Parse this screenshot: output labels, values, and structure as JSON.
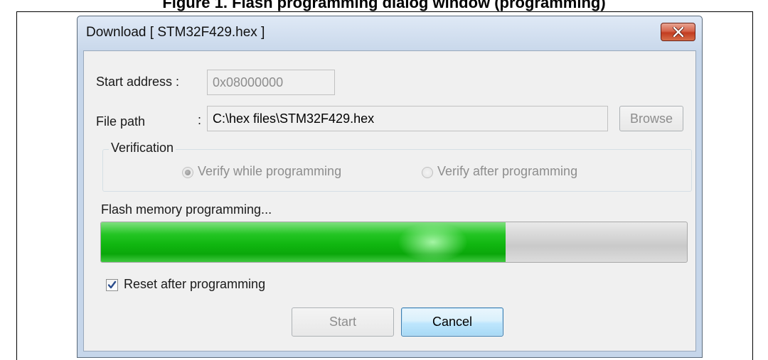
{
  "page": {
    "caption": "Figure 1. Flash programming dialog window (programming)"
  },
  "window": {
    "title": "Download [ STM32F429.hex ]"
  },
  "form": {
    "start_address_label": "Start address :",
    "start_address_value": "0x08000000",
    "file_path_label": "File path",
    "file_path_colon": ":",
    "file_path_value": "C:\\hex files\\STM32F429.hex",
    "browse_label": "Browse"
  },
  "verification": {
    "legend": "Verification",
    "options": [
      {
        "label": "Verify while programming",
        "selected": true,
        "enabled": false
      },
      {
        "label": "Verify after programming",
        "selected": false,
        "enabled": false
      }
    ]
  },
  "progress": {
    "status_text": "Flash memory programming...",
    "fraction": 0.69,
    "color": "#11b711"
  },
  "options": {
    "reset_after_programming_label": "Reset after programming",
    "reset_after_programming_checked": true
  },
  "buttons": {
    "start_label": "Start",
    "start_enabled": false,
    "cancel_label": "Cancel"
  },
  "icons": {
    "close": "close-icon",
    "check": "checkmark-icon"
  },
  "colors": {
    "title_bar": "#c9d8eb",
    "close_button": "#c33c20",
    "checkmark": "#2a4c8c"
  }
}
